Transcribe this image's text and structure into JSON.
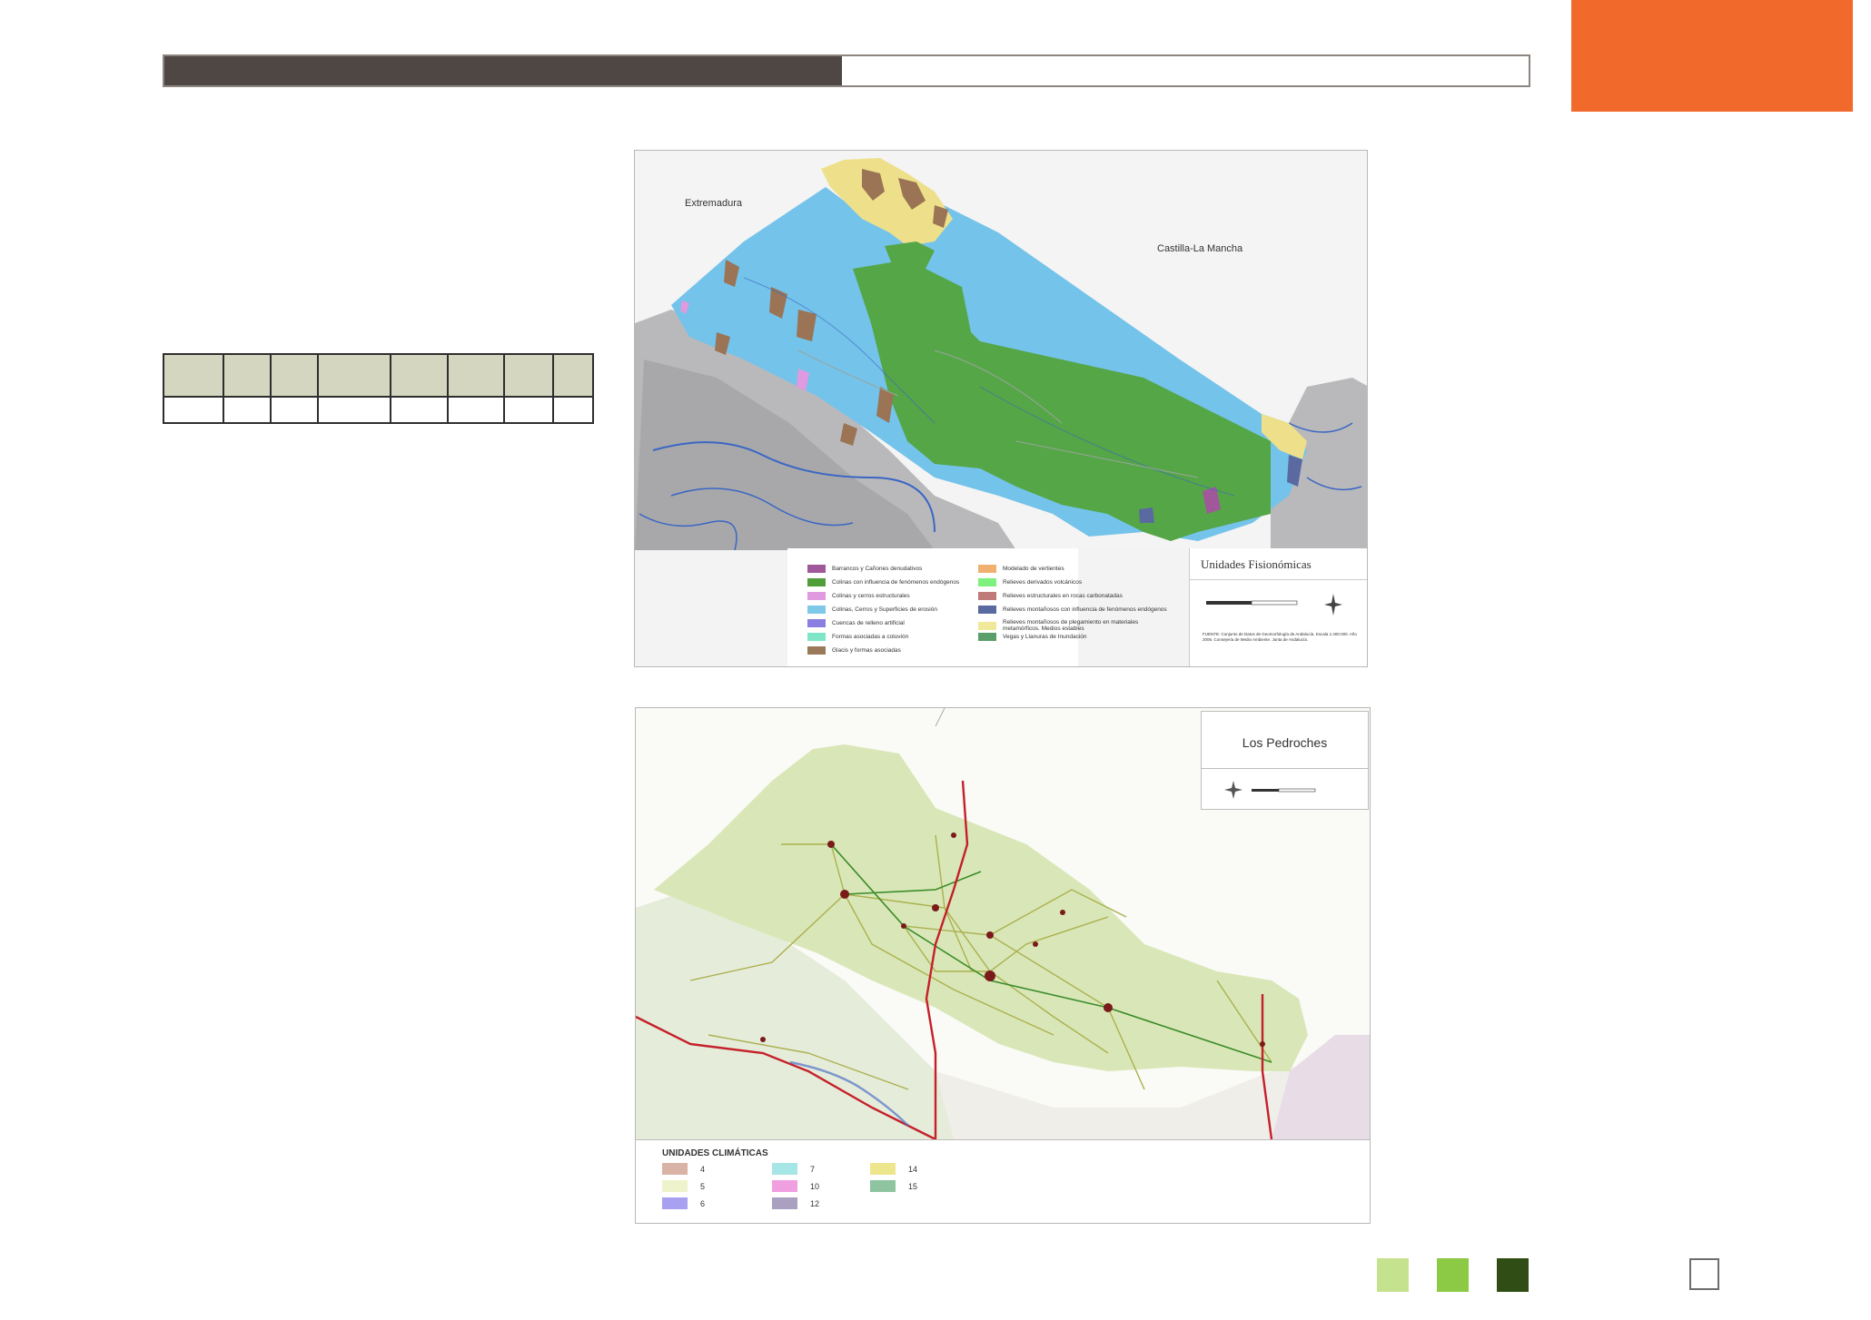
{
  "header": {
    "bar_fill_color": "#4f4743",
    "accent_color": "#f26a2b"
  },
  "table": {
    "column_count": 8,
    "header_color": "#d4d6bf"
  },
  "map_fisionomicas": {
    "region_labels": {
      "west": "Extremadura",
      "east": "Castilla-La Mancha"
    },
    "legend_title": "Unidades Fisionómicas",
    "legend_items_left": [
      {
        "label": "Barrancos y Cañones denudativos",
        "color": "#a0589a"
      },
      {
        "label": "Colinas con influencia de fenómenos endógenos",
        "color": "#4f9e3a"
      },
      {
        "label": "Colinas y cerros estructurales",
        "color": "#e09ae0"
      },
      {
        "label": "Colinas, Cerros y Superficies de erosión",
        "color": "#7ec8e8"
      },
      {
        "label": "Cuencas de relleno artificial",
        "color": "#8a7ee0"
      },
      {
        "label": "Formas asociadas a coluvión",
        "color": "#7ee6c6"
      },
      {
        "label": "Glacis y formas asociadas",
        "color": "#9a7a5a"
      }
    ],
    "legend_items_right": [
      {
        "label": "Modelado de vertientes",
        "color": "#f0b070"
      },
      {
        "label": "Relieves derivados volcánicos",
        "color": "#7ef07e"
      },
      {
        "label": "Relieves estructurales en rocas carbonatadas",
        "color": "#c07a7a"
      },
      {
        "label": "Relieves montañosos con influencia de fenómenos endógenos",
        "color": "#5a6aa0"
      },
      {
        "label": "Relieves montañosos de plegamiento en materiales metamórficos. Medios estables",
        "color": "#f0e89a"
      },
      {
        "label": "Vegas y Llanuras de Inundación",
        "color": "#5a9e6a"
      }
    ],
    "source_note": "FUENTE: Conjunto de Datos de Geomorfología de Andalucía. Escala 1:400.000. Año 2006. Consejería de Medio Ambiente. Junta de Andalucía."
  },
  "map_climaticas": {
    "title": "Los Pedroches",
    "legend_title": "UNIDADES CLIMÁTICAS",
    "legend_items": [
      {
        "label": "4",
        "color": "#d9b3a6"
      },
      {
        "label": "7",
        "color": "#a6e6e6"
      },
      {
        "label": "14",
        "color": "#eee68c"
      },
      {
        "label": "5",
        "color": "#eef3cc"
      },
      {
        "label": "10",
        "color": "#f0a0e0"
      },
      {
        "label": "15",
        "color": "#8fc4a0"
      },
      {
        "label": "6",
        "color": "#a8a0f0"
      },
      {
        "label": "12",
        "color": "#aaa0c0"
      }
    ]
  },
  "footer_swatches": [
    {
      "name": "light-green",
      "color": "#c5e28e"
    },
    {
      "name": "green",
      "color": "#8cc944"
    },
    {
      "name": "dark-green",
      "color": "#2f4d14"
    }
  ]
}
